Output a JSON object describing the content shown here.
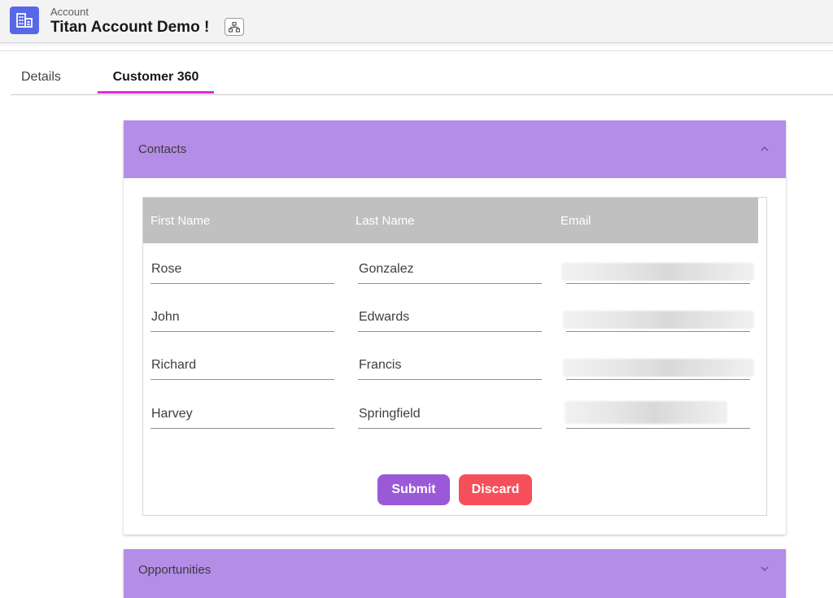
{
  "header": {
    "object_label": "Account",
    "record_title": "Titan Account Demo !",
    "icon": "building-icon",
    "hierarchy_icon": "hierarchy-icon"
  },
  "tabs": [
    {
      "label": "Details",
      "active": false
    },
    {
      "label": "Customer 360",
      "active": true
    }
  ],
  "colors": {
    "tab_active_underline": "#e628d8",
    "section_header": "#b48de6",
    "table_header": "#c0c0c0",
    "submit": "#9a5ad8",
    "discard": "#f5505a",
    "app_icon": "#5867e8"
  },
  "contacts": {
    "title": "Contacts",
    "expanded": true,
    "columns": [
      "First Name",
      "Last Name",
      "Email"
    ],
    "rows": [
      {
        "first": "Rose",
        "last": "Gonzalez"
      },
      {
        "first": "John",
        "last": "Edwards"
      },
      {
        "first": "Richard",
        "last": "Francis"
      },
      {
        "first": "Harvey",
        "last": "Springfield"
      }
    ],
    "submit_label": "Submit",
    "discard_label": "Discard"
  },
  "opportunities": {
    "title": "Opportunities",
    "expanded": false
  }
}
